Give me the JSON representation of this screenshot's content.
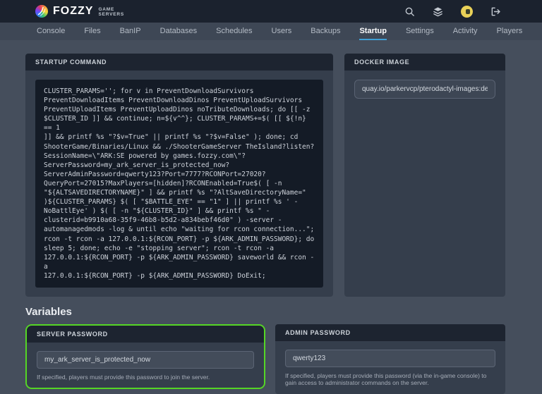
{
  "topbar": {
    "brand": {
      "name": "FOZZY",
      "tagline_line1": "GAME",
      "tagline_line2": "SERVERS"
    },
    "icons": {
      "search": "search-icon",
      "stack": "stack-icon",
      "user": "user-avatar",
      "logout": "logout-icon"
    }
  },
  "nav": {
    "items": [
      {
        "label": "Console",
        "active": false
      },
      {
        "label": "Files",
        "active": false
      },
      {
        "label": "BanIP",
        "active": false
      },
      {
        "label": "Databases",
        "active": false
      },
      {
        "label": "Schedules",
        "active": false
      },
      {
        "label": "Users",
        "active": false
      },
      {
        "label": "Backups",
        "active": false
      },
      {
        "label": "Startup",
        "active": true
      },
      {
        "label": "Settings",
        "active": false
      },
      {
        "label": "Activity",
        "active": false
      },
      {
        "label": "Players",
        "active": false
      }
    ]
  },
  "startup_panel": {
    "title": "STARTUP COMMAND",
    "command": "CLUSTER_PARAMS=''; for v in PreventDownloadSurvivors\nPreventDownloadItems PreventDownloadDinos PreventUploadSurvivors\nPreventUploadItems PreventUploadDinos noTributeDownloads; do [[ -z\n$CLUSTER_ID ]] && continue; n=${v^^}; CLUSTER_PARAMS+=$( [[ ${!n} == 1\n]] && printf %s \"?$v=True\" || printf %s \"?$v=False\" ); done; cd\nShooterGame/Binaries/Linux && ./ShooterGameServer TheIsland?listen?\nSessionName=\\\"ARK:SE powered by games.fozzy.com\\\"?\nServerPassword=my_ark_server_is_protected_now?\nServerAdminPassword=qwerty123?Port=7777?RCONPort=27020?\nQueryPort=27015?MaxPlayers=[hidden]?RCONEnabled=True$( [ -n\n\"${ALTSAVEDIRECTORYNAME}\" ] && printf %s \"?AltSaveDirectoryName=\"\n)${CLUSTER_PARAMS} $( [ \"$BATTLE_EYE\" == \"1\" ] || printf %s ' -\nNoBattlEye' ) $( [ -n \"${CLUSTER_ID}\" ] && printf %s \" -\nclusterid=b9910a68-35f9-46b8-b5d2-a834bebf46d0\" ) -server -\nautomanagedmods -log & until echo \"waiting for rcon connection...\";\nrcon -t rcon -a 127.0.0.1:${RCON_PORT} -p ${ARK_ADMIN_PASSWORD}; do\nsleep 5; done; echo -e \"stopping server\"; rcon -t rcon -a\n127.0.0.1:${RCON_PORT} -p ${ARK_ADMIN_PASSWORD} saveworld && rcon -a\n127.0.0.1:${RCON_PORT} -p ${ARK_ADMIN_PASSWORD} DoExit;"
  },
  "docker_panel": {
    "title": "DOCKER IMAGE",
    "image_value": "quay.io/parkervcp/pterodactyl-images:debian_source"
  },
  "variables": {
    "heading": "Variables",
    "server_password": {
      "title": "SERVER PASSWORD",
      "value": "my_ark_server_is_protected_now",
      "description": "If specified, players must provide this password to join the server.",
      "highlighted": true
    },
    "admin_password": {
      "title": "ADMIN PASSWORD",
      "value": "qwerty123",
      "description": "If specified, players must provide this password (via the in-game console) to gain access to administrator commands on the server.",
      "highlighted": false
    }
  },
  "colors": {
    "topbar_bg": "#1b222e",
    "navbar_bg": "#3e4755",
    "page_bg": "#454e5c",
    "panel_header_bg": "#1d2430",
    "panel_body_bg": "#353e4c",
    "code_bg": "#141b26",
    "tab_underline": "#3f9fd6",
    "highlight_green": "#55d625",
    "avatar_yellow": "#e9d158"
  }
}
